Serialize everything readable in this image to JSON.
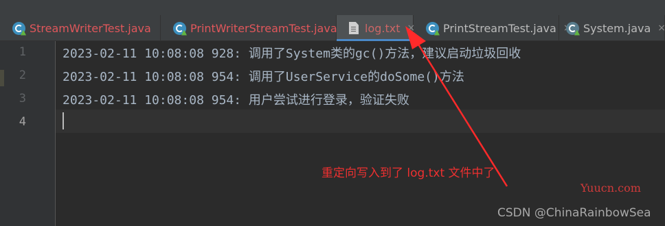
{
  "tabs": [
    {
      "label": "StreamWriterTest.java",
      "icon": "java-class-icon",
      "closable": false
    },
    {
      "label": "PrintWriterStreamTest.java",
      "icon": "java-class-icon",
      "closable": true
    },
    {
      "label": "log.txt",
      "icon": "text-file-icon",
      "closable": true,
      "active": true
    },
    {
      "label": "PrintStreamTest.java",
      "icon": "java-class-icon",
      "closable": true
    },
    {
      "label": "System.java",
      "icon": "java-class-icon",
      "closable": true
    }
  ],
  "close_glyph": "×",
  "editor": {
    "line_numbers": [
      "1",
      "2",
      "3",
      "4"
    ],
    "lines": [
      "2023-02-11 10:08:08 928: 调用了System类的gc()方法，建议启动垃圾回收",
      "2023-02-11 10:08:08 954: 调用了UserService的doSome()方法",
      "2023-02-11 10:08:08 954: 用户尝试进行登录，验证失败",
      ""
    ],
    "current_line": 4
  },
  "annotation": "重定向写入到了 log.txt 文件中了",
  "watermarks": [
    "Yuucn.com",
    "CSDN @ChinaRainbowSea"
  ],
  "colors": {
    "accent": "#4a88c7",
    "annotation": "#ee3030",
    "arrow": "#ff2a2a"
  }
}
